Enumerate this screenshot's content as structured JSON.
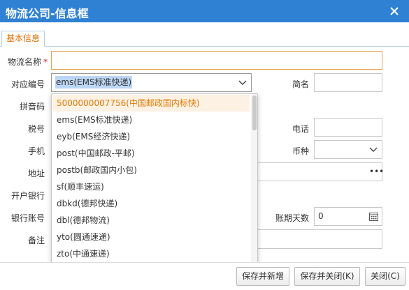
{
  "window": {
    "title": "物流公司-信息框"
  },
  "tabs": [
    {
      "label": "基本信息"
    }
  ],
  "form": {
    "name_label": "物流名称",
    "name_required": "*",
    "name_value": "",
    "code_label": "对应编号",
    "code_value": "ems(EMS标准快递)",
    "short_label": "简名",
    "short_value": "",
    "pinyin_label": "拼音码",
    "tax_label": "税号",
    "phone_label": "电话",
    "phone_value": "",
    "mobile_label": "手机",
    "currency_label": "币种",
    "currency_value": "",
    "address_label": "地址",
    "bank_label": "开户银行",
    "account_label": "银行账号",
    "days_label": "账期天数",
    "days_value": "0",
    "note_label": "备注"
  },
  "dropdown": {
    "options": [
      "5000000007756(中国邮政国内标快)",
      "ems(EMS标准快递)",
      "eyb(EMS经济快递)",
      "post(中国邮政-平邮)",
      "postb(邮政国内小包)",
      "sf(顺丰速运)",
      "dbkd(德邦快递)",
      "dbl(德邦物流)",
      "yto(圆通速递)",
      "zto(中通速递)"
    ],
    "highlighted_index": 0
  },
  "footer": {
    "save_new": "保存并新增",
    "save_close": "保存并关闭(K)",
    "close": "关闭(C)"
  },
  "colors": {
    "titlebar": "#2f81d4",
    "tab_text": "#e06b00",
    "highlight_text": "#e07a00",
    "required": "#e02020"
  },
  "icons": {
    "close": "close-icon",
    "chevron": "chevron-down-icon",
    "more": "ellipsis-icon",
    "calendar": "calendar-icon"
  }
}
